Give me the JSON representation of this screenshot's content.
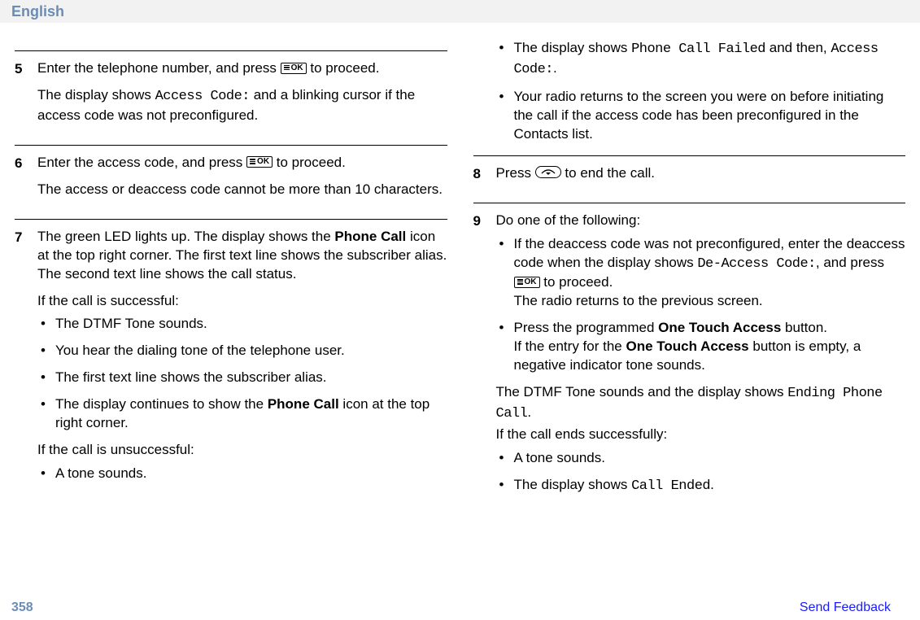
{
  "header": {
    "language": "English"
  },
  "footer": {
    "page": "358",
    "feedback": "Send Feedback"
  },
  "left": {
    "step5": {
      "num": "5",
      "p1a": "Enter the telephone number, and press ",
      "p1b": " to proceed.",
      "p2a": "The display shows ",
      "p2code": "Access Code:",
      "p2b": " and a blinking cursor if the access code was not preconfigured."
    },
    "step6": {
      "num": "6",
      "p1a": "Enter the access code, and press ",
      "p1b": " to proceed.",
      "p2": "The access or deaccess code cannot be more than 10 characters."
    },
    "step7": {
      "num": "7",
      "p1a": "The green LED lights up. The display shows the ",
      "p1bold1": "Phone Call",
      "p1b": " icon at the top right corner. The first text line shows the subscriber alias. The second text line shows the call status.",
      "p2": "If the call is successful:",
      "b1": "The DTMF Tone sounds.",
      "b2": "You hear the dialing tone of the telephone user.",
      "b3": "The first text line shows the subscriber alias.",
      "b4a": "The display continues to show the ",
      "b4bold": "Phone Call",
      "b4b": " icon at the top right corner.",
      "p3": "If the call is unsuccessful:",
      "b5": "A tone sounds."
    }
  },
  "right": {
    "cont": {
      "b1a": "The display shows ",
      "b1code1": "Phone Call Failed",
      "b1mid": " and then, ",
      "b1code2": "Access Code:",
      "b1end": ".",
      "b2": "Your radio returns to the screen you were on before initiating the call if the access code has been preconfigured in the Contacts list."
    },
    "step8": {
      "num": "8",
      "p1a": "Press ",
      "p1b": " to end the call."
    },
    "step9": {
      "num": "9",
      "p1": "Do one of the following:",
      "b1a": "If the deaccess code was not preconfigured, enter the deaccess code when the display shows ",
      "b1code": "De-Access Code:",
      "b1b": ", and press ",
      "b1c": " to proceed.",
      "b1d": "The radio returns to the previous screen.",
      "b2a": "Press the programmed ",
      "b2bold": "One Touch Access",
      "b2b": " button.",
      "b2c": "If the entry for the ",
      "b2bold2": "One Touch Access",
      "b2d": " button is empty, a negative indicator tone sounds.",
      "p2a": "The DTMF Tone sounds and the display shows ",
      "p2code": "Ending Phone Call",
      "p2b": ".",
      "p3": "If the call ends successfully:",
      "b3": "A tone sounds.",
      "b4a": "The display shows ",
      "b4code": "Call Ended",
      "b4b": "."
    }
  }
}
